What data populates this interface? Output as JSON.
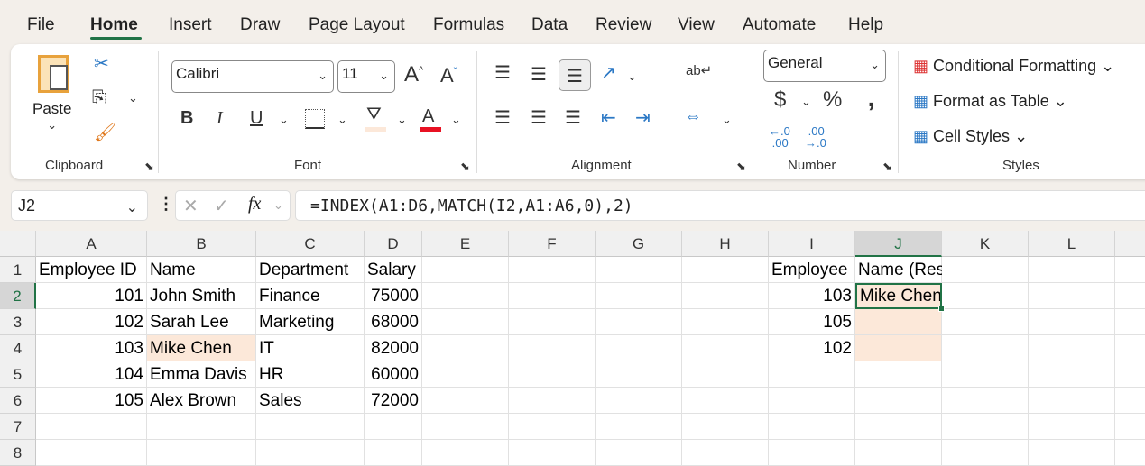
{
  "menu_tabs": [
    "File",
    "Home",
    "Insert",
    "Draw",
    "Page Layout",
    "Formulas",
    "Data",
    "Review",
    "View",
    "Automate",
    "Help"
  ],
  "active_tab": "Home",
  "clipboard": {
    "paste_label": "Paste",
    "group_label": "Clipboard"
  },
  "font": {
    "name": "Calibri",
    "size": "11",
    "group_label": "Font",
    "fill_color": "#fce8d9",
    "font_color": "#e81123"
  },
  "alignment": {
    "group_label": "Alignment"
  },
  "number": {
    "format": "General",
    "currency": "$",
    "percent": "%",
    "comma": " ,",
    "group_label": "Number"
  },
  "styles": {
    "conditional": "Conditional Formatting",
    "format_table": "Format as Table",
    "cell_styles": "Cell Styles",
    "group_label": "Styles"
  },
  "formula_bar": {
    "name_box": "J2",
    "fx": "fx",
    "formula": "=INDEX(A1:D6,MATCH(I2,A1:A6,0),2)"
  },
  "columns": [
    "A",
    "B",
    "C",
    "D",
    "E",
    "F",
    "G",
    "H",
    "I",
    "J",
    "K",
    "L"
  ],
  "rows": [
    "1",
    "2",
    "3",
    "4",
    "5",
    "6",
    "7",
    "8"
  ],
  "cells": {
    "A1": "Employee ID",
    "B1": "Name",
    "C1": "Department",
    "D1": "Salary",
    "A2": "101",
    "B2": "John Smith",
    "C2": "Finance",
    "D2": "75000",
    "A3": "102",
    "B3": "Sarah Lee",
    "C3": "Marketing",
    "D3": "68000",
    "A4": "103",
    "B4": "Mike Chen",
    "C4": "IT",
    "D4": "82000",
    "A5": "104",
    "B5": "Emma Davis",
    "C5": "HR",
    "D5": "60000",
    "A6": "105",
    "B6": "Alex Brown",
    "C6": "Sales",
    "D6": "72000",
    "I1": "Employee",
    "J1": "Name (Result)",
    "I2": "103",
    "J2": "Mike Chen",
    "I3": "105",
    "I4": "102"
  },
  "selected_cell": "J2",
  "accent": "#217346",
  "highlight_color": "#fce8d9"
}
